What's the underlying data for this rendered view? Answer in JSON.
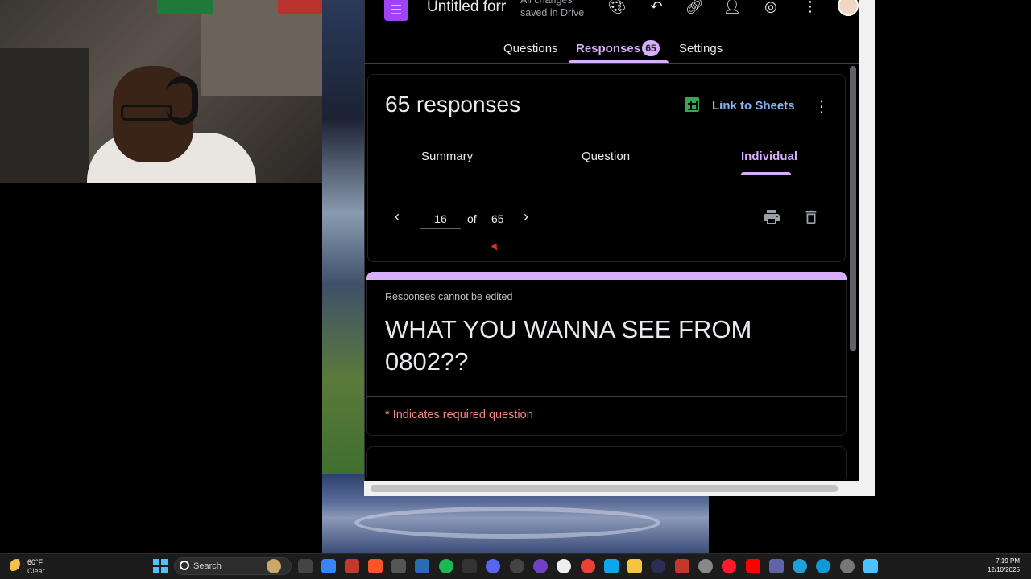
{
  "form": {
    "title": "Untitled forr",
    "save_status": "All changes saved in Drive"
  },
  "tabs": {
    "questions": "Questions",
    "responses": "Responses",
    "responses_count": "65",
    "settings": "Settings"
  },
  "summary": {
    "count_text": "65 responses",
    "link_sheets": "Link to Sheets",
    "sub_tabs": {
      "summary": "Summary",
      "question": "Question",
      "individual": "Individual"
    },
    "pager": {
      "current": "16",
      "of": "of",
      "total": "65"
    }
  },
  "response": {
    "not_editable": "Responses cannot be edited",
    "heading": "WHAT YOU WANNA SEE FROM 0802??",
    "required_note": "* Indicates required question"
  },
  "taskbar": {
    "weather_temp": "60°F",
    "weather_desc": "Clear",
    "search_placeholder": "Search",
    "time": "7:19 PM",
    "date": "12/10/2025"
  },
  "colors": {
    "accent": "#d7aefb",
    "link": "#8ab4f8",
    "required": "#f28b82",
    "sheets": "#34a853",
    "forms": "#a142f4"
  }
}
